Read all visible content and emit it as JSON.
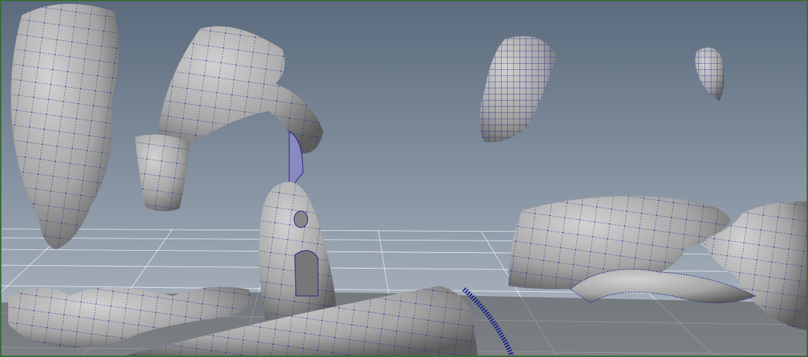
{
  "viewport": {
    "colors": {
      "sky_top": "#5b6b7d",
      "sky_bottom": "#b3bcc6",
      "mesh_fill": "#a9a9a9",
      "wire": "#1a1f8c",
      "grid": "#ffffff",
      "border": "#3a6a3a",
      "ground": "#4e4e4e"
    }
  }
}
